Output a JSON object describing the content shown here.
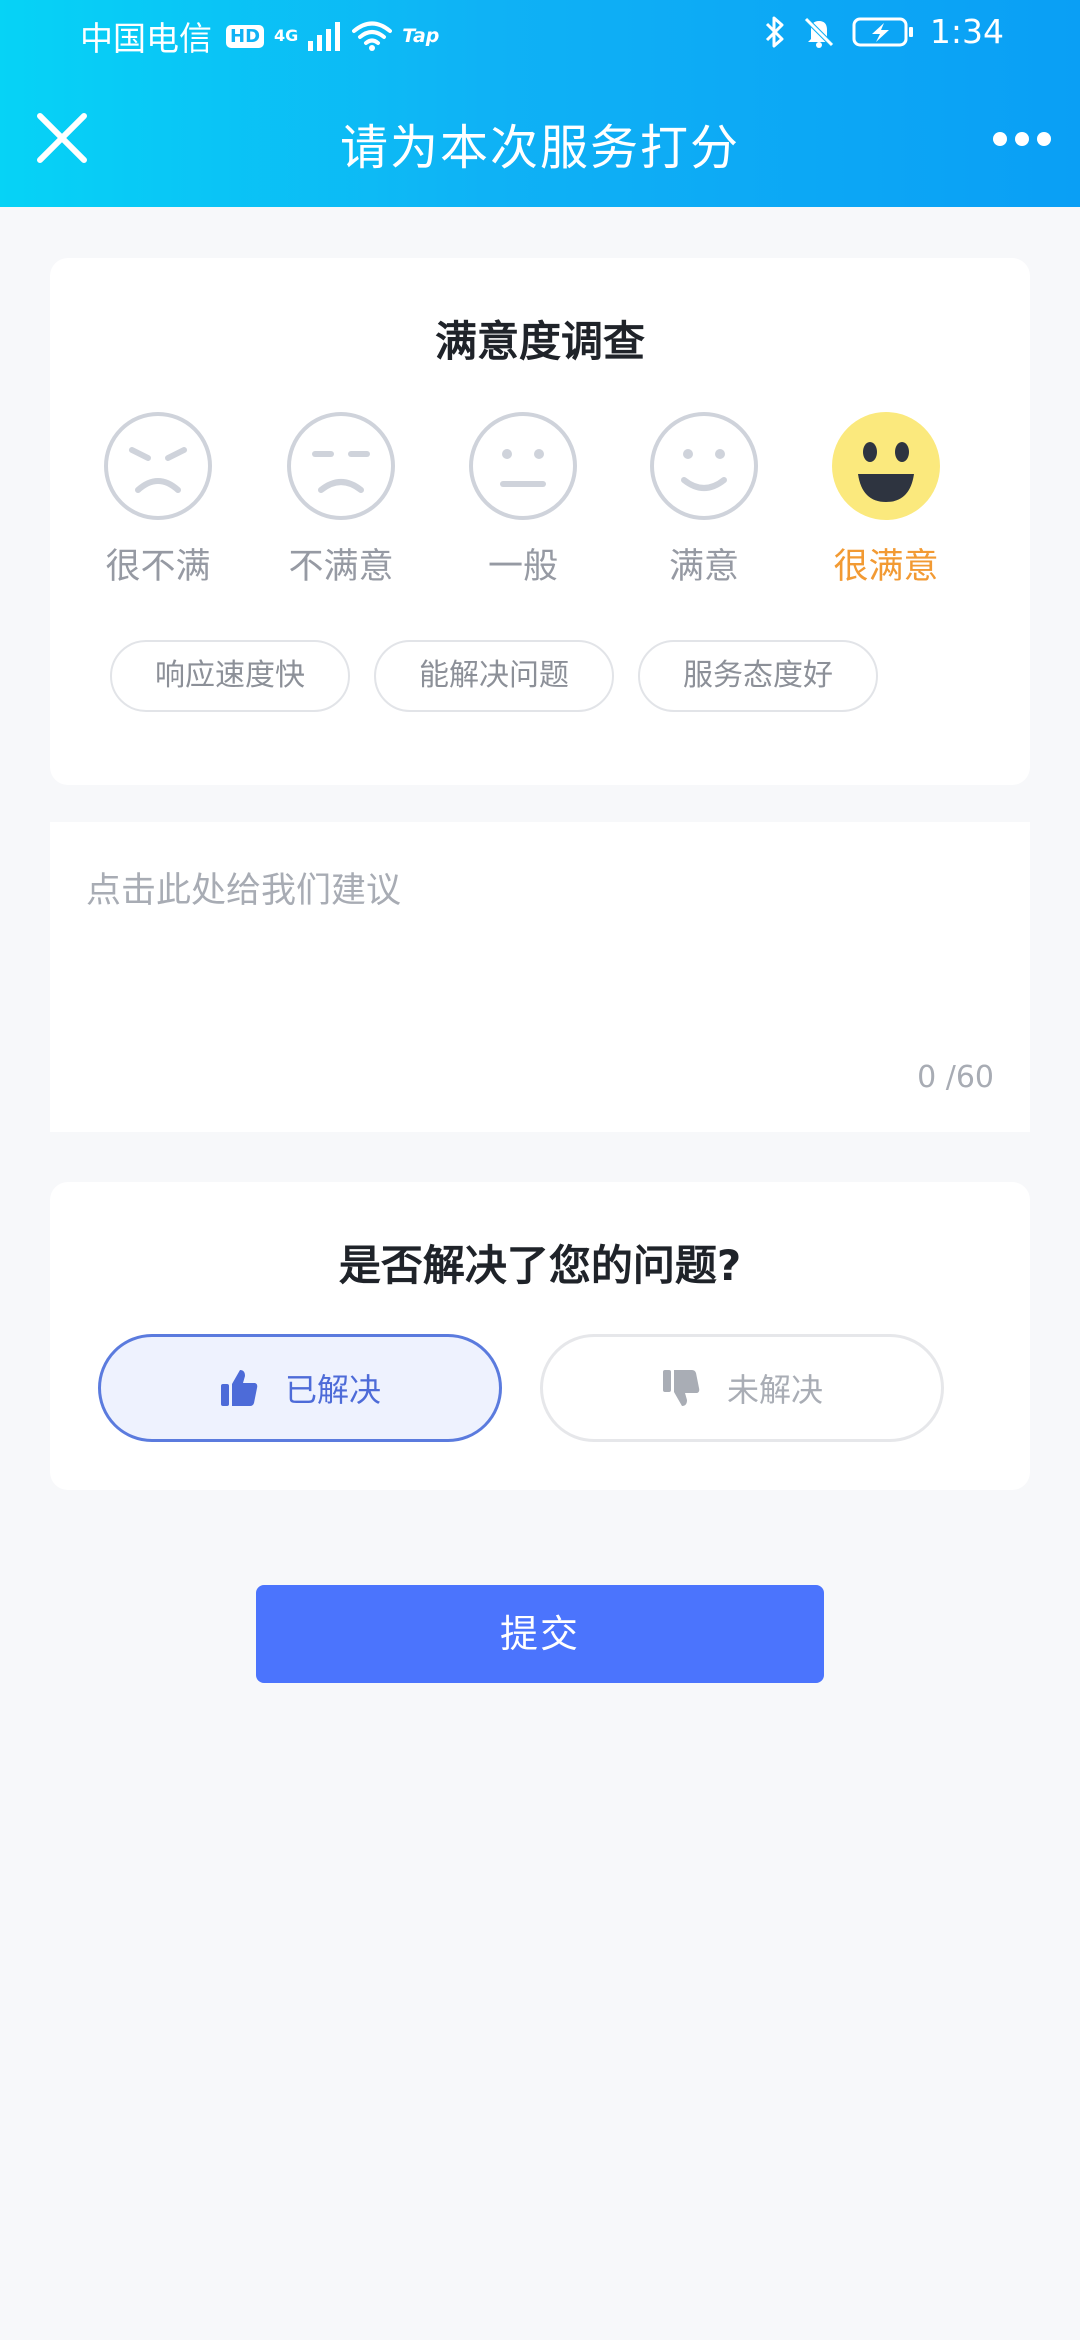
{
  "status_bar": {
    "carrier": "中国电信",
    "hd": "HD",
    "network": "4G",
    "tap": "Tap",
    "time": "1:34"
  },
  "nav": {
    "title": "请为本次服务打分"
  },
  "survey": {
    "title": "满意度调查",
    "faces": [
      {
        "label": "很不满"
      },
      {
        "label": "不满意"
      },
      {
        "label": "一般"
      },
      {
        "label": "满意"
      },
      {
        "label": "很满意"
      }
    ],
    "selected_label": "很满意",
    "tags": [
      "响应速度快",
      "能解决问题",
      "服务态度好"
    ]
  },
  "suggestion": {
    "placeholder": "点击此处给我们建议",
    "count": "0 /60"
  },
  "resolved": {
    "title": "是否解决了您的问题?",
    "yes_label": "已解决",
    "no_label": "未解决",
    "selected": "已解决"
  },
  "submit_label": "提交",
  "colors": {
    "header_gradient_start": "#06d3f6",
    "header_gradient_end": "#0a9ff5",
    "selected_face": "#fbe97d",
    "selected_label": "#f29a33",
    "submit": "#4b74fd"
  }
}
